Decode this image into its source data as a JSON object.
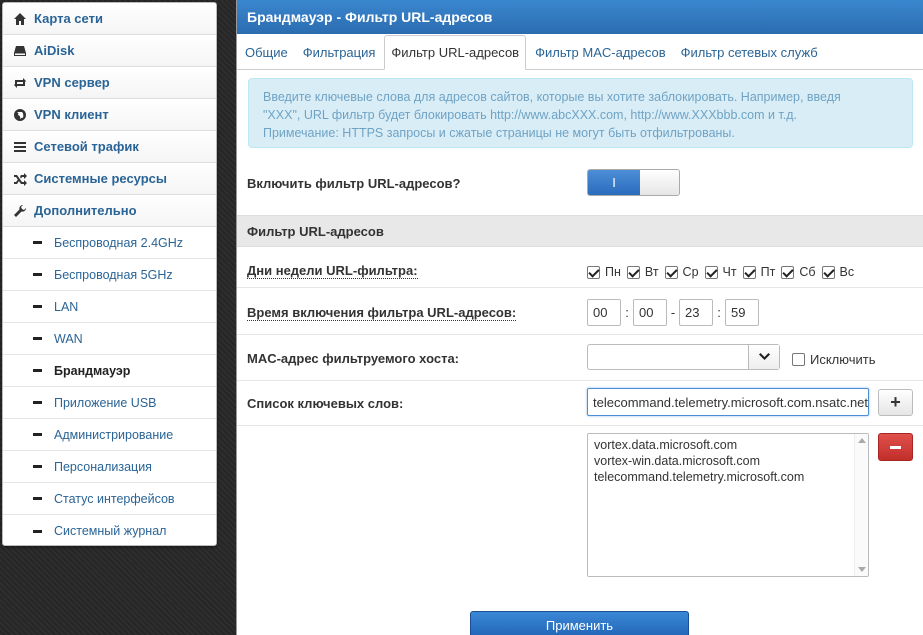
{
  "sidebar": {
    "main_items": [
      {
        "label": "Карта сети",
        "icon": "home-icon"
      },
      {
        "label": "AiDisk",
        "icon": "hdd-icon"
      },
      {
        "label": "VPN сервер",
        "icon": "retweet-icon"
      },
      {
        "label": "VPN клиент",
        "icon": "globe-icon"
      },
      {
        "label": "Сетевой трафик",
        "icon": "list-icon"
      },
      {
        "label": "Системные ресурсы",
        "icon": "random-icon"
      },
      {
        "label": "Дополнительно",
        "icon": "wrench-icon"
      }
    ],
    "sub_items": [
      {
        "label": "Беспроводная 2.4GHz"
      },
      {
        "label": "Беспроводная 5GHz"
      },
      {
        "label": "LAN"
      },
      {
        "label": "WAN"
      },
      {
        "label": "Брандмауэр",
        "active": true
      },
      {
        "label": "Приложение USB"
      },
      {
        "label": "Администрирование"
      },
      {
        "label": "Персонализация"
      },
      {
        "label": "Статус интерфейсов"
      },
      {
        "label": "Системный журнал"
      }
    ]
  },
  "panel": {
    "title": "Брандмауэр - Фильтр URL-адресов",
    "tabs": [
      {
        "label": "Общие"
      },
      {
        "label": "Фильтрация"
      },
      {
        "label": "Фильтр URL-адресов",
        "active": true
      },
      {
        "label": "Фильтр MAC-адресов"
      },
      {
        "label": "Фильтр сетевых служб"
      }
    ],
    "info": {
      "line1": "Введите ключевые слова для адресов сайтов, которые вы хотите заблокировать. Например, введя",
      "line2": "\"XXX\", URL фильтр будет блокировать http://www.abcXXX.com, http://www.XXXbbb.com и т.д.",
      "line3": "Примечание: HTTPS запросы и сжатые страницы не могут быть отфильтрованы."
    },
    "enable_label": "Включить фильтр URL-адресов?",
    "enable_toggle_on_label": "I",
    "enable_state": true,
    "section_title": "Фильтр URL-адресов",
    "days_label": "Дни недели URL-фильтра:",
    "days": [
      {
        "label": "Пн",
        "checked": true
      },
      {
        "label": "Вт",
        "checked": true
      },
      {
        "label": "Ср",
        "checked": true
      },
      {
        "label": "Чт",
        "checked": true
      },
      {
        "label": "Пт",
        "checked": true
      },
      {
        "label": "Сб",
        "checked": true
      },
      {
        "label": "Вс",
        "checked": true
      }
    ],
    "time_label": "Время включения фильтра URL-адресов:",
    "time": {
      "start_h": "00",
      "start_m": "00",
      "end_h": "23",
      "end_m": "59",
      "colon": ":",
      "dash": "-"
    },
    "mac_label": "MAC-адрес фильтруемого хоста:",
    "mac_value": "",
    "exclude_label": "Исключить",
    "keywords_label": "Список ключевых слов:",
    "keyword_input": "telecommand.telemetry.microsoft.com.nsatc.net",
    "add_button": "+",
    "keywords": [
      "vortex.data.microsoft.com",
      "vortex-win.data.microsoft.com",
      "telecommand.telemetry.microsoft.com"
    ],
    "apply_label": "Применить"
  },
  "colors": {
    "accent": "#2b6cb0",
    "link": "#2a6496",
    "danger": "#c22f2a",
    "info_bg": "#d9edf7"
  }
}
